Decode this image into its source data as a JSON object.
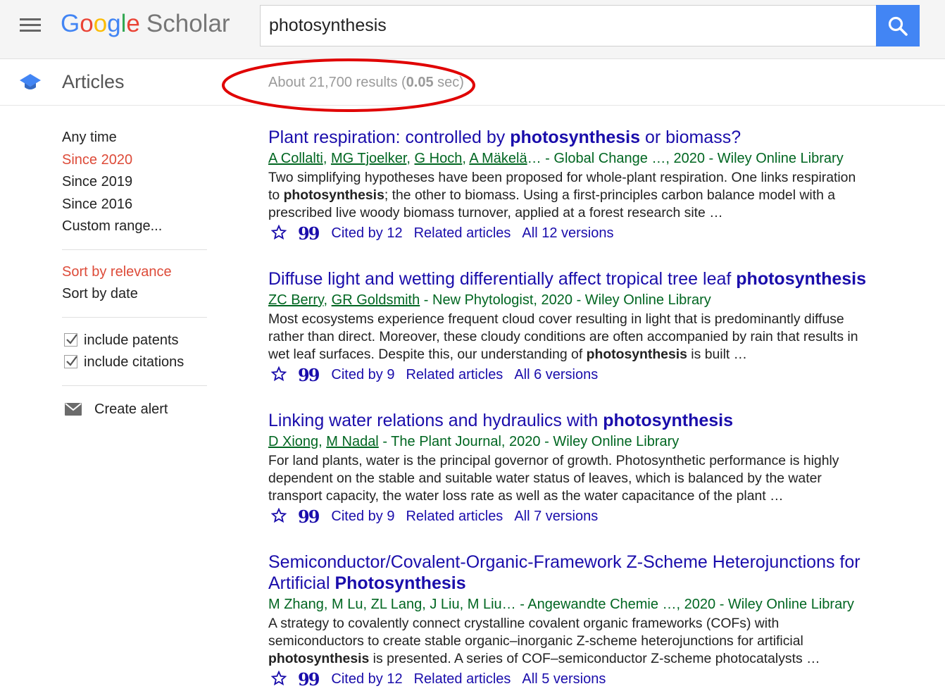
{
  "header": {
    "logo_google": [
      "G",
      "o",
      "o",
      "g",
      "l",
      "e"
    ],
    "logo_google_colors": [
      "#4285f4",
      "#ea4335",
      "#fbbc05",
      "#4285f4",
      "#34a853",
      "#ea4335"
    ],
    "logo_scholar": "Scholar",
    "search_value": "photosynthesis",
    "accent_color": "#4285f4"
  },
  "subheader": {
    "section_label": "Articles",
    "result_count_prefix": "About 21,700 results (",
    "result_time": "0.05",
    "result_count_suffix": " sec)"
  },
  "sidebar": {
    "time_filters": [
      {
        "label": "Any time",
        "active": false
      },
      {
        "label": "Since 2020",
        "active": true
      },
      {
        "label": "Since 2019",
        "active": false
      },
      {
        "label": "Since 2016",
        "active": false
      },
      {
        "label": "Custom range...",
        "active": false
      }
    ],
    "sort_options": [
      {
        "label": "Sort by relevance",
        "active": true
      },
      {
        "label": "Sort by date",
        "active": false
      }
    ],
    "checkboxes": [
      {
        "label": "include patents",
        "checked": true
      },
      {
        "label": "include citations",
        "checked": true
      }
    ],
    "create_alert": "Create alert",
    "active_color": "#dd4b39"
  },
  "results": [
    {
      "title_parts": [
        {
          "text": "Plant respiration: controlled by ",
          "bold": false
        },
        {
          "text": "photosynthesis",
          "bold": true
        },
        {
          "text": " or biomass?",
          "bold": false
        }
      ],
      "authors": [
        "A Collalti",
        "MG Tjoelker",
        "G Hoch",
        "A Mäkelä"
      ],
      "authors_truncated": true,
      "source": " - Global Change …, 2020 - Wiley Online Library",
      "snippet_parts": [
        {
          "text": "Two simplifying hypotheses have been proposed for whole-plant respiration. One links respiration to ",
          "bold": false
        },
        {
          "text": "photosynthesis",
          "bold": true
        },
        {
          "text": "; the other to biomass. Using a first-principles carbon balance model with a prescribed live woody biomass turnover, applied at a forest research site …",
          "bold": false
        }
      ],
      "cited_by": "Cited by 12",
      "related": "Related articles",
      "versions": "All 12 versions"
    },
    {
      "title_parts": [
        {
          "text": "Diffuse light and wetting differentially affect tropical tree leaf ",
          "bold": false
        },
        {
          "text": "photosynthesis",
          "bold": true
        }
      ],
      "authors": [
        "ZC Berry",
        "GR Goldsmith"
      ],
      "authors_truncated": false,
      "source": " - New Phytologist, 2020 - Wiley Online Library",
      "snippet_parts": [
        {
          "text": "Most ecosystems experience frequent cloud cover resulting in light that is predominantly diffuse rather than direct. Moreover, these cloudy conditions are often accompanied by rain that results in wet leaf surfaces. Despite this, our understanding of ",
          "bold": false
        },
        {
          "text": "photosynthesis",
          "bold": true
        },
        {
          "text": " is built …",
          "bold": false
        }
      ],
      "cited_by": "Cited by 9",
      "related": "Related articles",
      "versions": "All 6 versions"
    },
    {
      "title_parts": [
        {
          "text": "Linking water relations and hydraulics with ",
          "bold": false
        },
        {
          "text": "photosynthesis",
          "bold": true
        }
      ],
      "authors": [
        "D Xiong",
        "M Nadal"
      ],
      "authors_truncated": false,
      "source": " - The Plant Journal, 2020 - Wiley Online Library",
      "snippet_parts": [
        {
          "text": "For land plants, water is the principal governor of growth. Photosynthetic performance is highly dependent on the stable and suitable water status of leaves, which is balanced by the water transport capacity, the water loss rate as well as the water capacitance of the plant …",
          "bold": false
        }
      ],
      "cited_by": "Cited by 9",
      "related": "Related articles",
      "versions": "All 7 versions"
    },
    {
      "title_parts": [
        {
          "text": "Semiconductor/Covalent-Organic-Framework Z-Scheme Heterojunctions for Artificial ",
          "bold": false
        },
        {
          "text": "Photosynthesis",
          "bold": true
        }
      ],
      "authors_plain": "M Zhang, M Lu, ZL Lang, J Liu, M Liu…",
      "source": " - Angewandte Chemie …, 2020 - Wiley Online Library",
      "snippet_parts": [
        {
          "text": "A strategy to covalently connect crystalline covalent organic frameworks (COFs) with semiconductors to create stable organic–inorganic Z-scheme heterojunctions for artificial ",
          "bold": false
        },
        {
          "text": "photosynthesis",
          "bold": true
        },
        {
          "text": " is presented. A series of COF–semiconductor Z-scheme photocatalysts …",
          "bold": false
        }
      ],
      "cited_by": "Cited by 12",
      "related": "Related articles",
      "versions": "All 5 versions"
    }
  ],
  "annotation": {
    "ellipse_color": "#e00000",
    "target": "result-count"
  }
}
